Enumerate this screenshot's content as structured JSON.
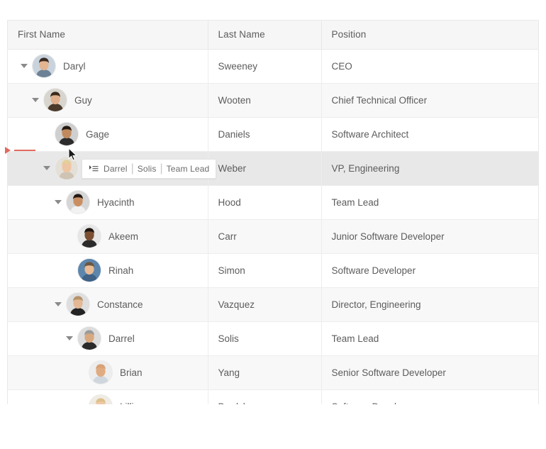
{
  "table": {
    "columns": [
      {
        "key": "first_name",
        "label": "First Name"
      },
      {
        "key": "last_name",
        "label": "Last Name"
      },
      {
        "key": "position",
        "label": "Position"
      }
    ],
    "rows": [
      {
        "first_name": "Daryl",
        "last_name": "Sweeney",
        "position": "CEO",
        "level": 0,
        "expanded": true,
        "has_children": true,
        "state": "plain",
        "avatar": "man-dark-hair"
      },
      {
        "first_name": "Guy",
        "last_name": "Wooten",
        "position": "Chief Technical Officer",
        "level": 1,
        "expanded": true,
        "has_children": true,
        "state": "alt",
        "avatar": "boy-brown-shirt"
      },
      {
        "first_name": "Gage",
        "last_name": "Daniels",
        "position": "Software Architect",
        "level": 2,
        "expanded": false,
        "has_children": false,
        "state": "plain",
        "avatar": "curly-hair-person"
      },
      {
        "first_name": "",
        "last_name": "Weber",
        "position": "VP, Engineering",
        "level": 2,
        "expanded": true,
        "has_children": true,
        "state": "dragging",
        "avatar": "blonde-woman"
      },
      {
        "first_name": "Hyacinth",
        "last_name": "Hood",
        "position": "Team Lead",
        "level": 3,
        "expanded": true,
        "has_children": true,
        "state": "plain",
        "avatar": "smiling-woman"
      },
      {
        "first_name": "Akeem",
        "last_name": "Carr",
        "position": "Junior Software Developer",
        "level": 4,
        "expanded": false,
        "has_children": false,
        "state": "alt",
        "avatar": "man-black-tshirt"
      },
      {
        "first_name": "Rinah",
        "last_name": "Simon",
        "position": "Software Developer",
        "level": 4,
        "expanded": false,
        "has_children": false,
        "state": "plain",
        "avatar": "man-glasses-blue"
      },
      {
        "first_name": "Constance",
        "last_name": "Vazquez",
        "position": "Director, Engineering",
        "level": 3,
        "expanded": true,
        "has_children": true,
        "state": "alt",
        "avatar": "short-hair-woman"
      },
      {
        "first_name": "Darrel",
        "last_name": "Solis",
        "position": "Team Lead",
        "level": 4,
        "expanded": true,
        "has_children": true,
        "state": "plain",
        "avatar": "gray-hair-man"
      },
      {
        "first_name": "Brian",
        "last_name": "Yang",
        "position": "Senior Software Developer",
        "level": 5,
        "expanded": false,
        "has_children": false,
        "state": "alt",
        "avatar": "bald-smiling-man"
      },
      {
        "first_name": "Lillian",
        "last_name": "Bradshaw",
        "position": "Software Developer",
        "level": 5,
        "expanded": false,
        "has_children": false,
        "state": "plain",
        "avatar": "blonde-long-hair"
      }
    ]
  },
  "drag": {
    "tooltip": {
      "icon": "drag-indicator-icon",
      "first_name": "Darrel",
      "last_name": "Solis",
      "position": "Team Lead",
      "separator": "|"
    },
    "drop_indicator": {
      "icon": "drop-arrow-icon",
      "color": "#e06a5e"
    },
    "cursor": "arrow-cursor"
  },
  "colors": {
    "header_bg": "#f6f6f6",
    "row_alt_bg": "#f8f8f8",
    "row_drag_bg": "#e8e8e8",
    "border": "#ededed",
    "text": "#5c5c5c",
    "drop_red": "#e06a5e"
  }
}
